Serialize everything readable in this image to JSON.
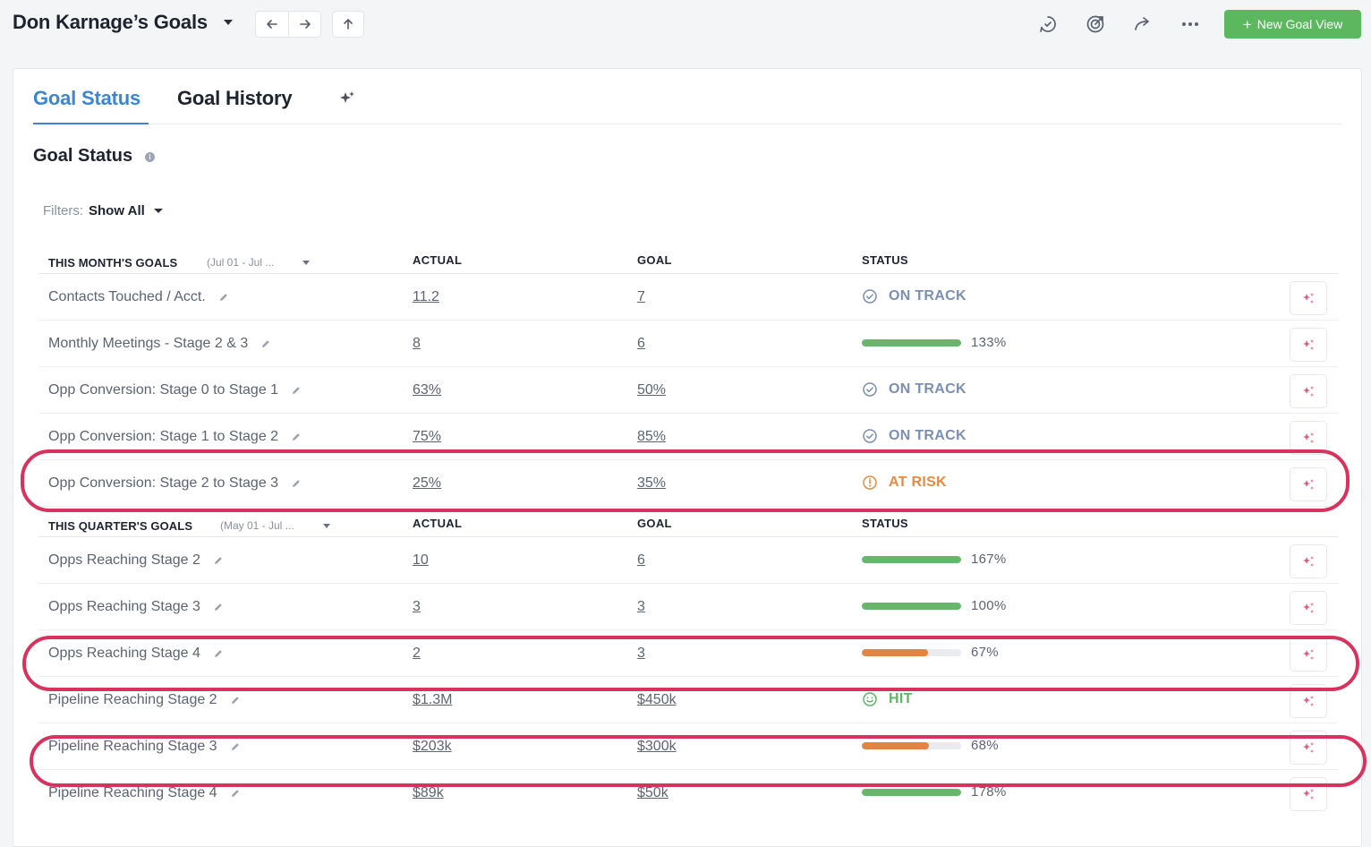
{
  "header": {
    "title": "Don Karnage’s Goals",
    "new_goal_label": "New Goal View",
    "back_icon": "arrow-left-icon",
    "forward_icon": "arrow-right-icon",
    "up_icon": "arrow-up-icon"
  },
  "tabs": {
    "goal_status": "Goal Status",
    "goal_history": "Goal History"
  },
  "section": {
    "title": "Goal Status"
  },
  "filters": {
    "label": "Filters:",
    "value": "Show All"
  },
  "groups": [
    {
      "title": "THIS MONTH'S GOALS",
      "range": "(Jul 01 - Jul ...",
      "col_actual": "ACTUAL",
      "col_goal": "GOAL",
      "col_status": "STATUS",
      "rows": [
        {
          "name": "Contacts Touched / Acct.",
          "actual": "11.2",
          "goal": "7",
          "status_type": "text",
          "status_text": "ON TRACK",
          "status_kind": "ontrack"
        },
        {
          "name": "Monthly Meetings - Stage 2 & 3",
          "actual": "8",
          "goal": "6",
          "status_type": "bar",
          "pct_text": "133%",
          "progress": 1.0,
          "bar_color": "#67b66c"
        },
        {
          "name": "Opp Conversion: Stage 0 to Stage 1",
          "actual": "63%",
          "goal": "50%",
          "status_type": "text",
          "status_text": "ON TRACK",
          "status_kind": "ontrack"
        },
        {
          "name": "Opp Conversion: Stage 1 to Stage 2",
          "actual": "75%",
          "goal": "85%",
          "status_type": "text",
          "status_text": "ON TRACK",
          "status_kind": "ontrack"
        },
        {
          "name": "Opp Conversion: Stage 2 to Stage 3",
          "actual": "25%",
          "goal": "35%",
          "status_type": "text",
          "status_text": "AT RISK",
          "status_kind": "atrisk"
        }
      ]
    },
    {
      "title": "THIS QUARTER'S GOALS",
      "range": "(May 01 - Jul ...",
      "col_actual": "ACTUAL",
      "col_goal": "GOAL",
      "col_status": "STATUS",
      "rows": [
        {
          "name": "Opps Reaching Stage 2",
          "actual": "10",
          "goal": "6",
          "status_type": "bar",
          "pct_text": "167%",
          "progress": 1.0,
          "bar_color": "#67b66c"
        },
        {
          "name": "Opps Reaching Stage 3",
          "actual": "3",
          "goal": "3",
          "status_type": "bar",
          "pct_text": "100%",
          "progress": 1.0,
          "bar_color": "#67b66c"
        },
        {
          "name": "Opps Reaching Stage 4",
          "actual": "2",
          "goal": "3",
          "status_type": "bar",
          "pct_text": "67%",
          "progress": 0.67,
          "bar_color": "#e08544"
        },
        {
          "name": "Pipeline Reaching Stage 2",
          "actual": "$1.3M",
          "goal": "$450k",
          "status_type": "text",
          "status_text": "HIT",
          "status_kind": "hit"
        },
        {
          "name": "Pipeline Reaching Stage 3",
          "actual": "$203k",
          "goal": "$300k",
          "status_type": "bar",
          "pct_text": "68%",
          "progress": 0.68,
          "bar_color": "#e08544"
        },
        {
          "name": "Pipeline Reaching Stage 4",
          "actual": "$89k",
          "goal": "$50k",
          "status_type": "bar",
          "pct_text": "178%",
          "progress": 1.0,
          "bar_color": "#67b66c"
        }
      ]
    }
  ],
  "colors": {
    "accent": "#3a86d4",
    "ontrack": "#7b8fb3",
    "atrisk": "#ea8a3e",
    "hit": "#5cb85f",
    "highlight": "#d7335e",
    "primary_button": "#5cb85f"
  }
}
